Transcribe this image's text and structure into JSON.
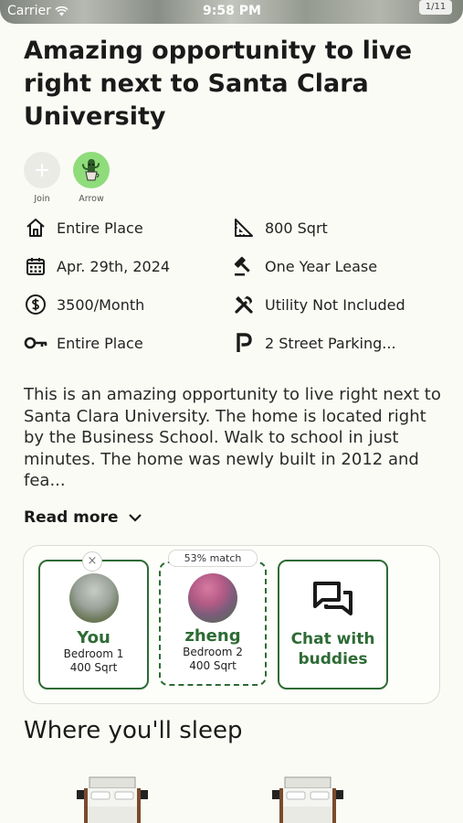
{
  "status_bar": {
    "carrier": "Carrier",
    "time": "9:58 PM",
    "pager": "1/11"
  },
  "listing": {
    "title": "Amazing opportunity to live right next to Santa Clara University"
  },
  "members": [
    {
      "label": "Join",
      "icon": "plus-icon"
    },
    {
      "label": "Arrow",
      "icon": "cactus-avatar"
    }
  ],
  "details": {
    "place_type": {
      "label": "Entire Place",
      "icon": "home-icon"
    },
    "size": {
      "label": "800 Sqrt",
      "icon": "ruler-triangle-icon"
    },
    "move_in": {
      "label": "Apr. 29th, 2024",
      "icon": "calendar-icon"
    },
    "lease": {
      "label": "One Year Lease",
      "icon": "gavel-icon"
    },
    "price": {
      "label": "3500/Month",
      "icon": "dollar-circle-icon"
    },
    "utilities": {
      "label": "Utility Not Included",
      "icon": "tools-icon"
    },
    "access": {
      "label": "Entire Place",
      "icon": "key-icon"
    },
    "parking": {
      "label": "2 Street Parking...",
      "icon": "parking-icon"
    }
  },
  "description": {
    "text": "This is an amazing opportunity to live right next to Santa Clara University. The home is located right by the Business School. Walk to school in just minutes.  The home was newly built in 2012 and fea...",
    "read_more_label": "Read more"
  },
  "rooms": {
    "you": {
      "name": "You",
      "bedroom": "Bedroom 1",
      "size": "400 Sqrt"
    },
    "match": {
      "badge": "53% match",
      "name": "zheng",
      "bedroom": "Bedroom 2",
      "size": "400 Sqrt"
    },
    "chat_label": "Chat with buddies",
    "remove_label": "×"
  },
  "sections": {
    "sleep_heading": "Where you'll sleep"
  },
  "colors": {
    "accent_green": "#2e6b35",
    "background": "#fbfbf5"
  }
}
